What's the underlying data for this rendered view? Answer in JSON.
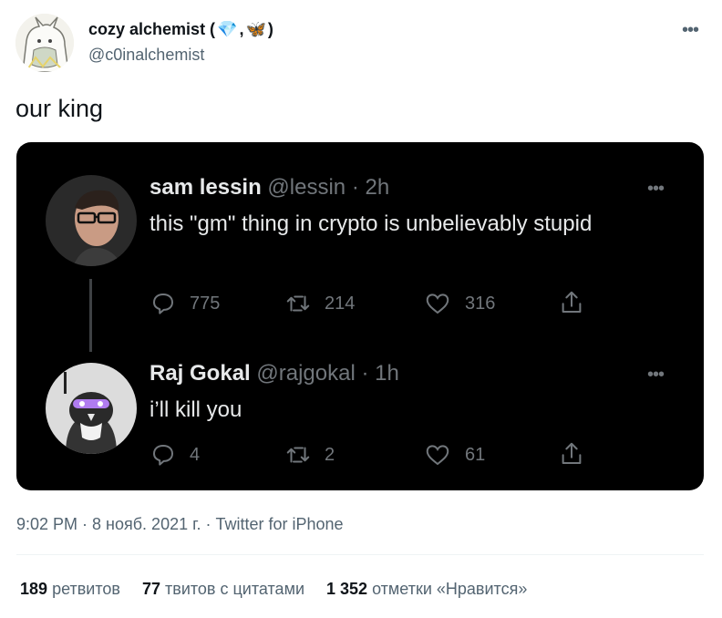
{
  "author": {
    "name": "cozy alchemist (",
    "name_emoji_1": "💎",
    "name_sep": ", ",
    "name_emoji_2": "🦋",
    "name_close": ")",
    "handle": "@c0inalchemist"
  },
  "tweet": {
    "text": "our king",
    "more_icon": "more-dots-icon"
  },
  "quoted_thread": [
    {
      "name": "sam lessin",
      "handle": "@lessin",
      "time": " · 2h",
      "text": "this \"gm\" thing in crypto is unbelievably stupid",
      "replies": "775",
      "retweets": "214",
      "likes": "316"
    },
    {
      "name": "Raj Gokal",
      "handle": "@rajgokal",
      "time": " · 1h",
      "text": "i’ll kill you",
      "replies": "4",
      "retweets": "2",
      "likes": "61"
    }
  ],
  "meta": {
    "timestamp": "9:02 PM · 8 нояб. 2021 г. · Twitter for iPhone"
  },
  "stats": {
    "retweets_count": "189",
    "retweets_label": "ретвитов",
    "quotes_count": "77",
    "quotes_label": "твитов с цитатами",
    "likes_count": "1 352",
    "likes_label": "отметки «Нравится»"
  },
  "colors": {
    "embed_bg": "#000000",
    "secondary_text": "#536471",
    "embed_text": "#e7e9ea",
    "embed_muted": "#71767b"
  }
}
